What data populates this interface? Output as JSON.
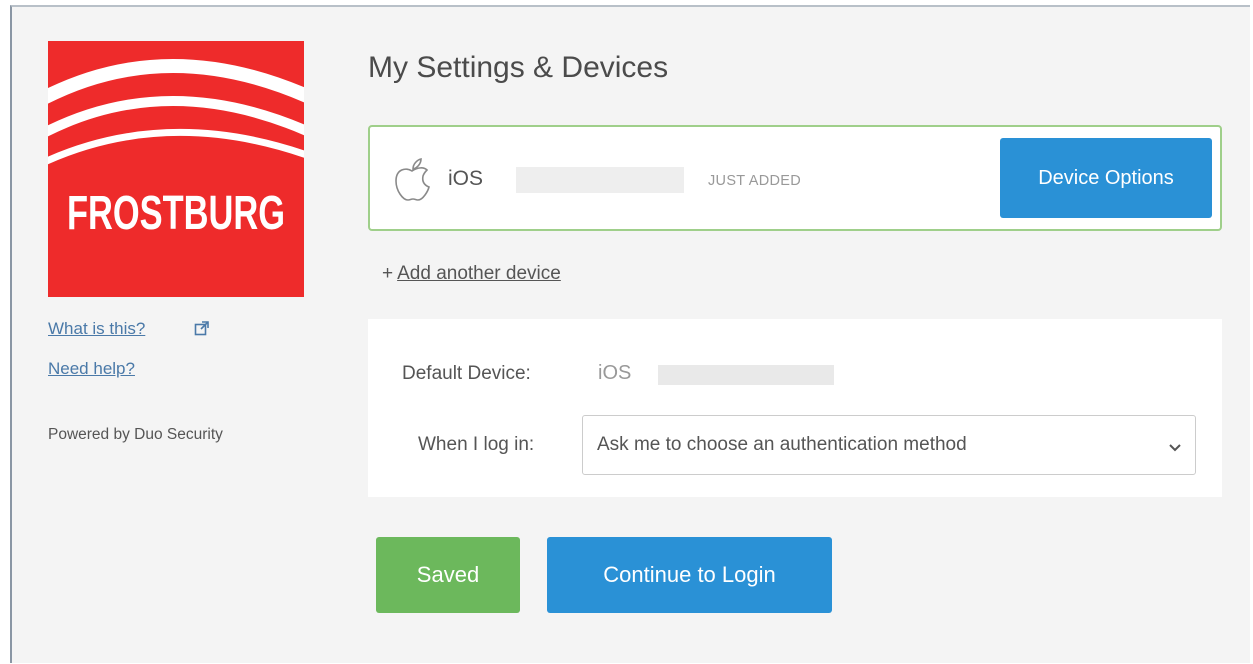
{
  "sidebar": {
    "logo_text": "FROSTBURG",
    "what_is_this": "What is this?",
    "need_help": "Need help?",
    "powered_by": "Powered by Duo Security"
  },
  "main": {
    "title": "My Settings & Devices",
    "device": {
      "name": "iOS",
      "status": "JUST ADDED",
      "options_label": "Device Options",
      "icon": "apple-icon"
    },
    "add_device": {
      "plus": "+",
      "label": "Add another device"
    },
    "settings": {
      "default_device_label": "Default Device:",
      "default_device_value": "iOS",
      "login_label": "When I log in:",
      "login_option": "Ask me to choose an authentication method"
    },
    "buttons": {
      "saved": "Saved",
      "continue": "Continue to Login"
    }
  },
  "colors": {
    "brand_red": "#ee2b2b",
    "primary_blue": "#2a91d6",
    "success_green": "#6cb85c",
    "card_border": "#9fcf8a"
  }
}
